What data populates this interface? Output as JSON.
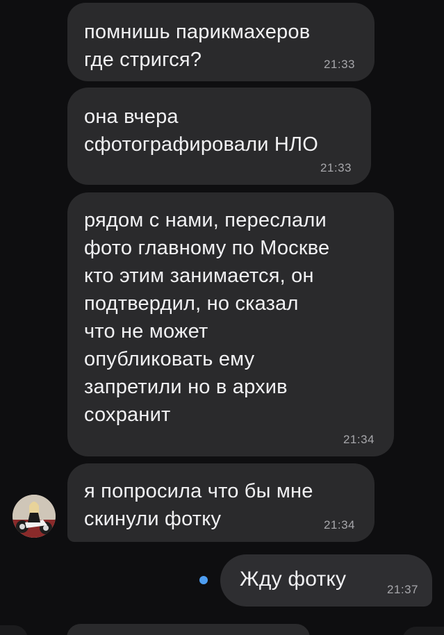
{
  "messages": [
    {
      "text": "помнишь парикмахеров\nгде стригся?",
      "time": "21:33"
    },
    {
      "text": "она вчера\nсфотографировали НЛО",
      "time": "21:33"
    },
    {
      "text": "рядом с нами, переслали\nфото главному по Москве\nкто этим занимается, он\nподтвердил, но сказал\nчто не может\nопубликовать ему\nзапретили но в архив\nсохранит",
      "time": "21:34"
    },
    {
      "text": "я попросила что бы мне\nскинули фотку",
      "time": "21:34"
    }
  ],
  "outgoing": {
    "text": "Жду фотку",
    "time": "21:37"
  },
  "sender_avatar": {
    "icon": "user-avatar"
  },
  "colors": {
    "background": "#0e0e10",
    "incoming_bubble": "#2a2a2c",
    "outgoing_bubble": "#2e2e31",
    "unread_dot": "#4e9ef2",
    "text": "#f1f1f3",
    "timestamp": "#a7a7ab"
  }
}
